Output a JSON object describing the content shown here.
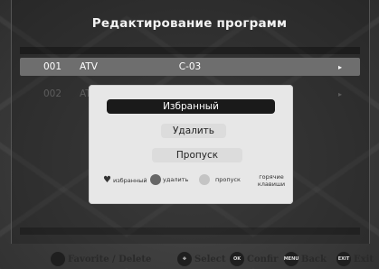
{
  "screen": {
    "title": "Редактирование программ"
  },
  "channels": [
    {
      "number": "001",
      "type": "ATV",
      "name": "C-03",
      "arrow": "▸"
    },
    {
      "number": "002",
      "type": "AT",
      "name": "",
      "arrow": "▸"
    }
  ],
  "dialog": {
    "options": [
      "Избранный",
      "Удалить",
      "Пропуск"
    ],
    "legend": {
      "favorite": "избранный",
      "delete": "удалить",
      "skip": "пропуск",
      "hotkeys": "горячие клавиши"
    }
  },
  "footer": {
    "favorite_delete": "Favorite / Delete",
    "select": "Select",
    "ok_key": "OK",
    "confirm": "Confir",
    "menu_key": "MENU",
    "back": "Back",
    "exit_key": "EXIT",
    "exit": "Exit"
  },
  "colors": {
    "legend_delete": "#666666",
    "legend_skip": "#c4c4c4",
    "selected_row": "#6e6e6e",
    "dialog_bg": "#e7e7e7",
    "selected_option": "#1a1a1a"
  }
}
